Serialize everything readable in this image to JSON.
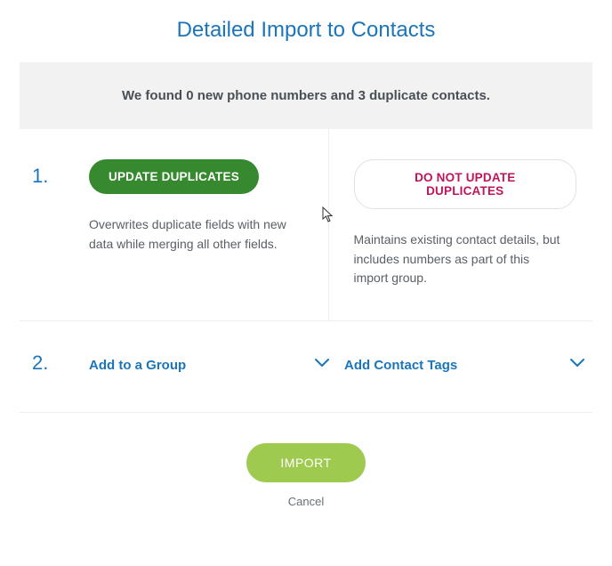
{
  "title": "Detailed Import to Contacts",
  "status": "We found 0 new phone numbers and 3 duplicate contacts.",
  "steps": {
    "one": "1.",
    "two": "2."
  },
  "update": {
    "button": "UPDATE DUPLICATES",
    "desc": "Overwrites duplicate fields with new data while merging all other fields."
  },
  "noupdate": {
    "button": "DO NOT UPDATE DUPLICATES",
    "desc": "Maintains existing contact details, but includes numbers as part of this import group."
  },
  "dropdowns": {
    "group": "Add to a Group",
    "tags": "Add Contact Tags"
  },
  "actions": {
    "import": "IMPORT",
    "cancel": "Cancel"
  }
}
